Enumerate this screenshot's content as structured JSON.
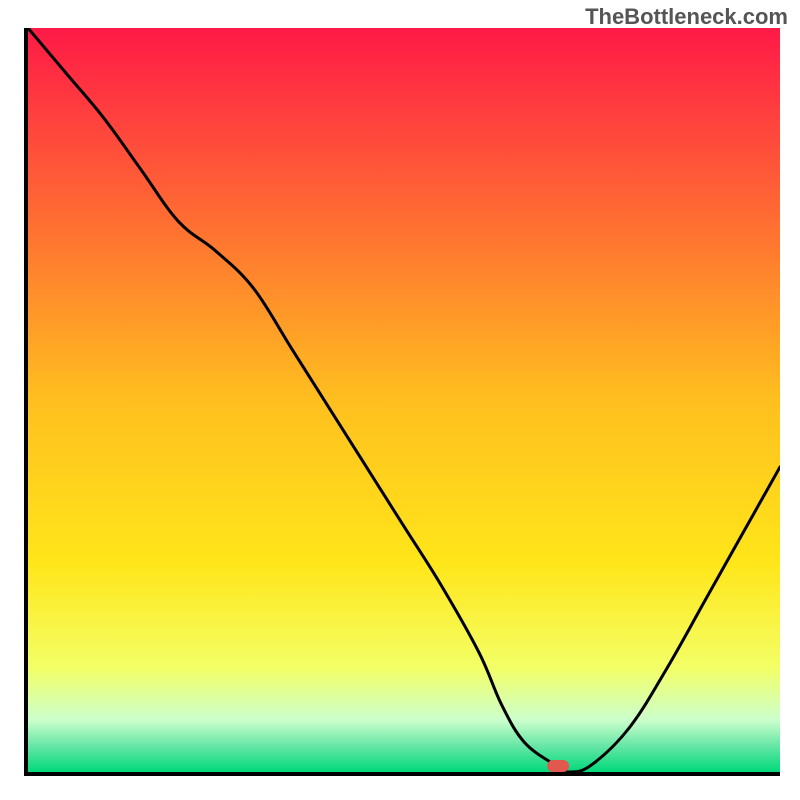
{
  "watermark": "TheBottleneck.com",
  "chart_data": {
    "type": "line",
    "title": "",
    "xlabel": "",
    "ylabel": "",
    "xlim": [
      0,
      100
    ],
    "ylim": [
      0,
      100
    ],
    "series": [
      {
        "name": "bottleneck-curve",
        "x": [
          0,
          5,
          10,
          15,
          20,
          25,
          30,
          35,
          40,
          45,
          50,
          55,
          60,
          63,
          66,
          70,
          72,
          75,
          80,
          85,
          90,
          95,
          100
        ],
        "y": [
          100,
          94,
          88,
          81,
          74,
          70,
          65,
          57,
          49,
          41,
          33,
          25,
          16,
          9,
          4,
          1,
          0,
          1,
          6,
          14,
          23,
          32,
          41
        ]
      }
    ],
    "marker": {
      "x": 70.5,
      "y": 0.8,
      "label": "optimal-point"
    },
    "background_gradient": {
      "stops": [
        {
          "offset": 0.0,
          "color": "#ff1a47"
        },
        {
          "offset": 0.25,
          "color": "#ff6a33"
        },
        {
          "offset": 0.5,
          "color": "#ffbf1f"
        },
        {
          "offset": 0.72,
          "color": "#ffe61a"
        },
        {
          "offset": 0.86,
          "color": "#f3ff66"
        },
        {
          "offset": 0.93,
          "color": "#ccffcc"
        },
        {
          "offset": 0.965,
          "color": "#66e6a6"
        },
        {
          "offset": 1.0,
          "color": "#00d979"
        }
      ]
    }
  }
}
